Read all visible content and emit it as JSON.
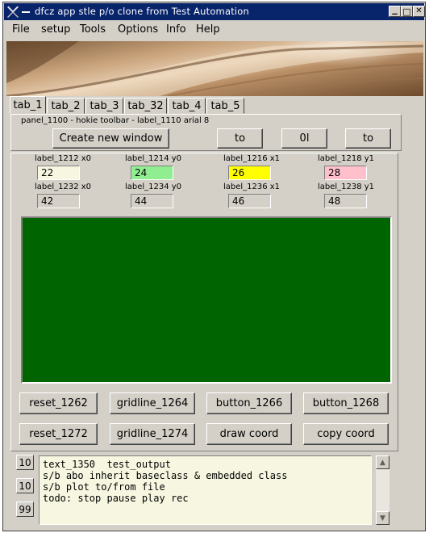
{
  "window": {
    "title": "dfcz app stle p/o clone from Test Automation",
    "controls": {
      "minimize": "▁",
      "maximize": "□",
      "close": "✕"
    }
  },
  "menu": [
    "File",
    "setup",
    "Tools",
    "Options",
    "Info",
    "Help"
  ],
  "banner": {
    "image": "sand-dune-photo"
  },
  "tabs": [
    "tab_1",
    "tab_2",
    "tab_3",
    "tab_32",
    "tab_4",
    "tab_5"
  ],
  "active_tab": "tab_1",
  "toolbar": {
    "title": "panel_1100 - hokie toolbar - label_1110 arial 8",
    "create_window": "Create new window",
    "btn_to1": "to",
    "btn_0l": "0l",
    "btn_to2": "to"
  },
  "coords_row1": [
    {
      "label": "label_1212 x0",
      "value": "22",
      "color": "#f7f7e1"
    },
    {
      "label": "label_1214 y0",
      "value": "24",
      "color": "#90ee90"
    },
    {
      "label": "label_1216 x1",
      "value": "26",
      "color": "#ffff00"
    },
    {
      "label": "label_1218 y1",
      "value": "28",
      "color": "#ffc0cb"
    }
  ],
  "coords_row2": [
    {
      "label": "label_1232 x0",
      "value": "42",
      "color": "#d4d0c8"
    },
    {
      "label": "label_1234 y0",
      "value": "44",
      "color": "#d4d0c8"
    },
    {
      "label": "label_1236 x1",
      "value": "46",
      "color": "#d4d0c8"
    },
    {
      "label": "label_1238 y1",
      "value": "48",
      "color": "#d4d0c8"
    }
  ],
  "canvas": {
    "color": "#006400"
  },
  "buttons_row1": [
    "reset_1262",
    "gridline_1264",
    "button_1266",
    "button_1268"
  ],
  "buttons_row2": [
    "reset_1272",
    "gridline_1274",
    "draw coord",
    "copy coord"
  ],
  "output": {
    "side_buttons": [
      "10",
      "10",
      "99"
    ],
    "text": "text_1350  test_output\ns/b abo inherit baseclass & embedded class\ns/b plot to/from file\ntodo: stop pause play rec"
  }
}
